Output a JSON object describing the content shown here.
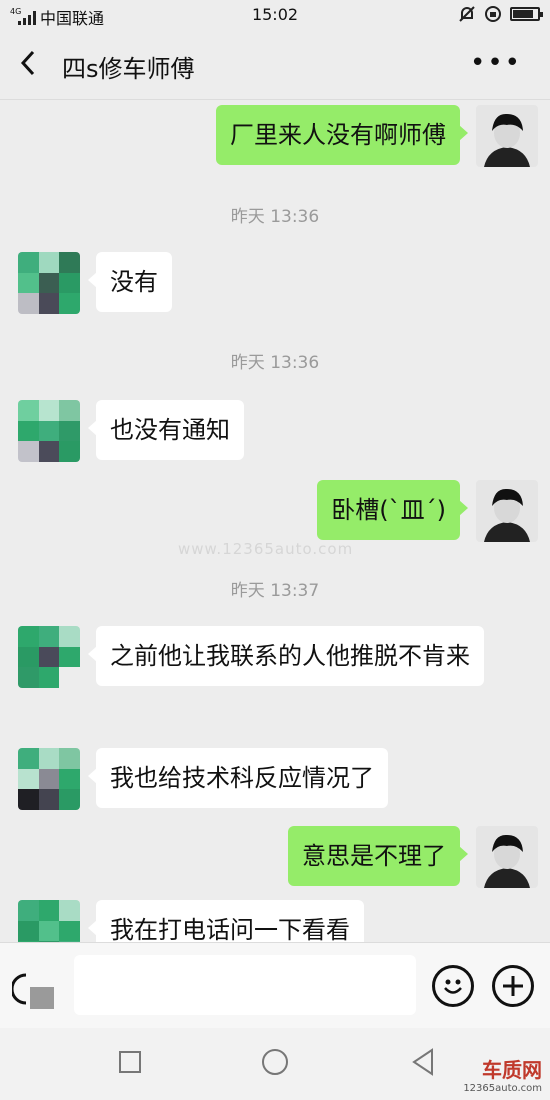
{
  "status_bar": {
    "network": "4G",
    "carrier": "中国联通",
    "time": "15:02"
  },
  "header": {
    "title": "四s修车师傅"
  },
  "messages": [
    {
      "side": "right",
      "text": "厂里来人没有啊师傅"
    },
    {
      "timestamp": "昨天 13:36"
    },
    {
      "side": "left",
      "text": "没有"
    },
    {
      "timestamp": "昨天 13:36"
    },
    {
      "side": "left",
      "text": "也没有通知"
    },
    {
      "side": "right",
      "text": "卧槽(`皿´)"
    },
    {
      "timestamp": "昨天 13:37"
    },
    {
      "side": "left",
      "text": "之前他让我联系的人他推脱不肯来"
    },
    {
      "side": "left",
      "text": "我也给技术科反应情况了"
    },
    {
      "side": "right",
      "text": "意思是不理了"
    },
    {
      "side": "left",
      "text": "我在打电话问一下看看"
    }
  ],
  "watermark": "www.12365auto.com",
  "logo": {
    "name": "车质网",
    "url": "12365auto.com"
  },
  "colors": {
    "background": "#ededed",
    "sent_bubble": "#95ec69",
    "received_bubble": "#ffffff"
  }
}
